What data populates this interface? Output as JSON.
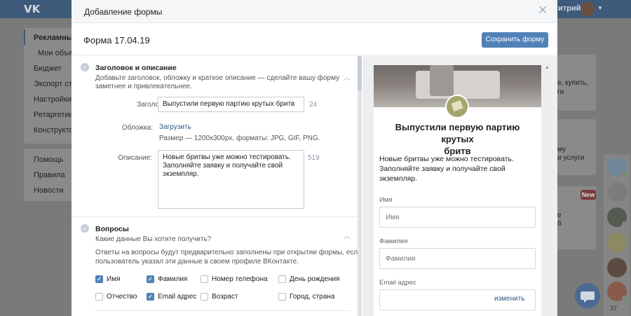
{
  "background": {
    "topbar": {
      "user_name": "итрий"
    },
    "nav_primary": [
      "Рекламные к",
      "Мои объявл",
      "Бюджет",
      "Экспорт стат",
      "Настройки",
      "Ретаргетинг",
      "Конструктор"
    ],
    "nav_secondary": [
      "Помощь",
      "Правила",
      "Новости"
    ],
    "snippets": [
      "е, купить,",
      "ги",
      "му",
      "и услуги",
      "е",
      "б"
    ],
    "new_badge": "New",
    "chat_count": "37"
  },
  "modal": {
    "title": "Добавление формы",
    "form_name": "Форма 17.04.19",
    "save_label": "Сохранить форму",
    "sections": {
      "header": {
        "title": "Заголовок и описание",
        "desc_line1": "Добавьте заголовок, обложку и краткое описание — сделайте вашу форму",
        "desc_line2": "заметнее и привлекательнее.",
        "fields": {
          "title_label": "Заголовок:",
          "title_value": "Выпустили первую партию крутых бритв",
          "title_counter": "24",
          "cover_label": "Обложка:",
          "cover_link": "Загрузить",
          "cover_hint": "Размер — 1200x300px, форматы: JPG, GIF, PNG.",
          "desc_label": "Описание:",
          "desc_line1": "Новые бритвы уже можно тестировать.",
          "desc_line2": "Заполняйте заявку и получайте свой",
          "desc_line3": "экземпляр.",
          "desc_counter": "519"
        }
      },
      "questions": {
        "title": "Вопросы",
        "subtitle": "Какие данные Вы хотите получить?",
        "desc_line1": "Ответы на вопросы будут предварительно заполнены при открытии формы, если",
        "desc_line2": "пользователь указал эти данные в своем профиле ВКонтакте.",
        "options": [
          {
            "label": "Имя",
            "checked": true
          },
          {
            "label": "Фамилия",
            "checked": true
          },
          {
            "label": "Номер телефона",
            "checked": false
          },
          {
            "label": "День рождения",
            "checked": false
          },
          {
            "label": "Отчество",
            "checked": false
          },
          {
            "label": "Email адрес",
            "checked": true
          },
          {
            "label": "Возраст",
            "checked": false
          },
          {
            "label": "Город, страна",
            "checked": false
          }
        ]
      }
    },
    "preview": {
      "title_line1": "Выпустили первую партию крутых",
      "title_line2": "бритв",
      "desc_line1": "Новые бритвы уже можно тестировать.",
      "desc_line2": "Заполняйте заявку и получайте свой",
      "desc_line3": "экземпляр.",
      "fields": [
        {
          "label": "Имя",
          "placeholder": "Имя"
        },
        {
          "label": "Фамилия",
          "placeholder": "Фамилия"
        },
        {
          "label": "Email адрес",
          "placeholder": ""
        }
      ],
      "change_link": "изменить"
    }
  },
  "colors": {
    "accent": "#5181b8",
    "link": "#2a5885",
    "topbar": "#4a76a8"
  }
}
